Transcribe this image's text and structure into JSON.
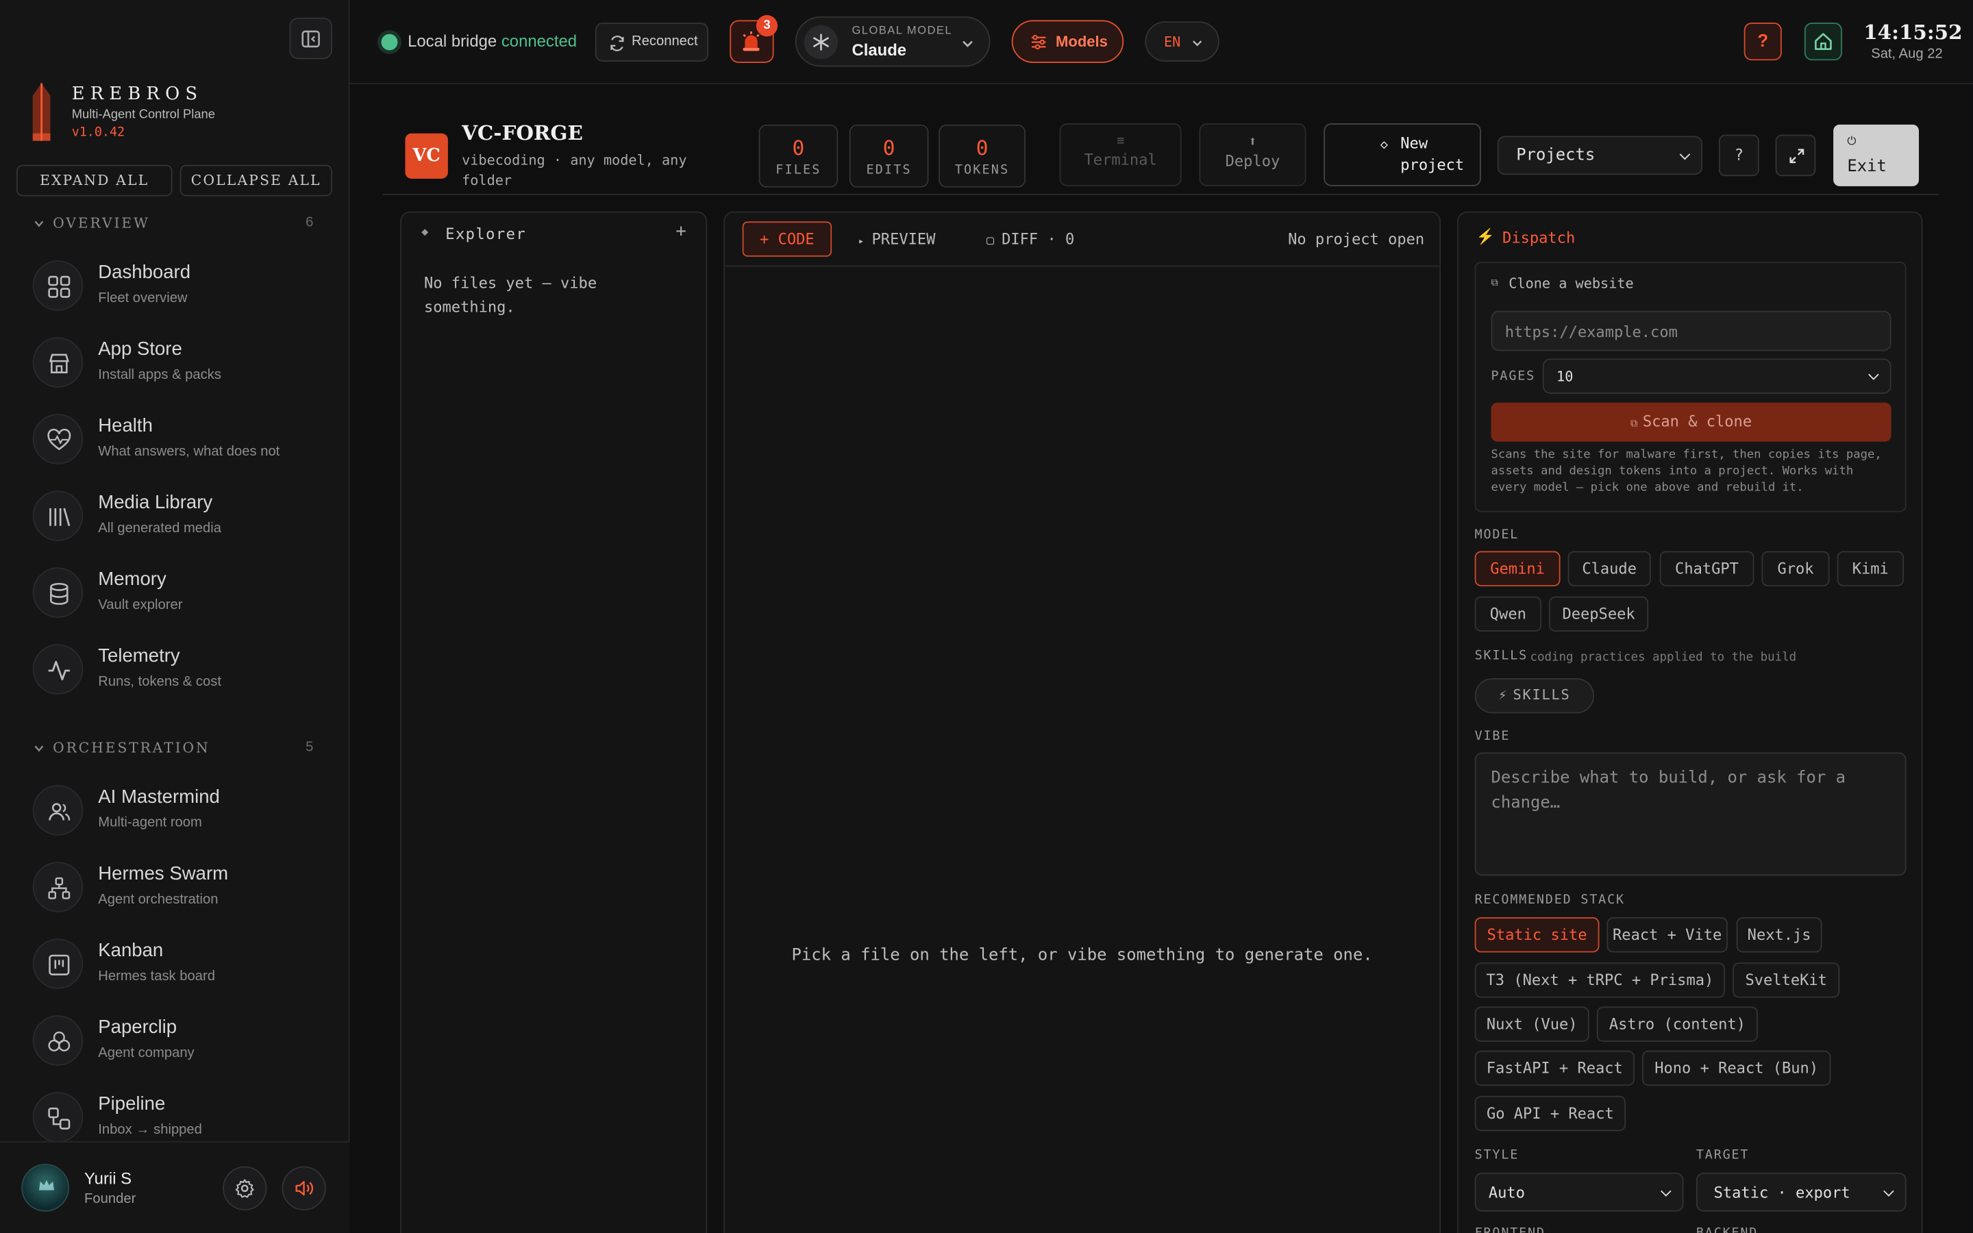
{
  "sidebar": {
    "brand": {
      "name": "EREBROS",
      "tagline": "Multi-Agent Control Plane",
      "version": "v1.0.42"
    },
    "expand_all": "EXPAND ALL",
    "collapse_all": "COLLAPSE ALL",
    "sections": [
      {
        "title": "OVERVIEW",
        "count": "6",
        "items": [
          {
            "label": "Dashboard",
            "sub": "Fleet overview",
            "icon": "grid-icon"
          },
          {
            "label": "App Store",
            "sub": "Install apps & packs",
            "icon": "store-icon"
          },
          {
            "label": "Health",
            "sub": "What answers, what does not",
            "icon": "heart-pulse-icon"
          },
          {
            "label": "Media Library",
            "sub": "All generated media",
            "icon": "library-icon"
          },
          {
            "label": "Memory",
            "sub": "Vault explorer",
            "icon": "database-icon"
          },
          {
            "label": "Telemetry",
            "sub": "Runs, tokens & cost",
            "icon": "activity-icon"
          }
        ]
      },
      {
        "title": "ORCHESTRATION",
        "count": "5",
        "items": [
          {
            "label": "AI Mastermind",
            "sub": "Multi-agent room",
            "icon": "users-icon"
          },
          {
            "label": "Hermes Swarm",
            "sub": "Agent orchestration",
            "icon": "network-icon"
          },
          {
            "label": "Kanban",
            "sub": "Hermes task board",
            "icon": "kanban-icon"
          },
          {
            "label": "Paperclip",
            "sub": "Agent company",
            "icon": "circles-icon"
          },
          {
            "label": "Pipeline",
            "sub": "Inbox → shipped",
            "icon": "workflow-icon"
          }
        ]
      }
    ],
    "user": {
      "name": "Yurii S",
      "role": "Founder"
    }
  },
  "topbar": {
    "bridge_text": "Local bridge",
    "bridge_status": "connected",
    "reconnect": "Reconnect",
    "alert_count": "3",
    "global_model_label": "GLOBAL MODEL",
    "global_model_value": "Claude",
    "models_button": "Models",
    "language": "EN",
    "help": "?",
    "clock_time": "14:15:52",
    "clock_date": "Sat, Aug 22"
  },
  "forge": {
    "logo": "VC",
    "title": "VC-FORGE",
    "subtitle": "vibecoding · any model, any folder",
    "stats": [
      {
        "value": "0",
        "label": "FILES"
      },
      {
        "value": "0",
        "label": "EDITS"
      },
      {
        "value": "0",
        "label": "TOKENS"
      }
    ],
    "terminal": "Terminal",
    "deploy": "Deploy",
    "new_project": "New project",
    "projects_select": "Projects",
    "help": "?",
    "exit": "Exit"
  },
  "explorer": {
    "title": "Explorer",
    "add": "+",
    "empty": "No files yet — vibe something."
  },
  "editor": {
    "tab_code": "+ CODE",
    "tab_preview": "PREVIEW",
    "tab_diff": "DIFF · 0",
    "status": "No project open",
    "placeholder": "Pick a file on the left, or vibe something to generate one."
  },
  "dispatch": {
    "title": "Dispatch",
    "clone": {
      "title": "Clone a website",
      "url_placeholder": "https://example.com",
      "pages_label": "PAGES",
      "pages_value": "10",
      "button": "Scan & clone",
      "description": "Scans the site for malware first, then copies its page, assets and design tokens into a project. Works with every model — pick one above and rebuild it."
    },
    "model_label": "MODEL",
    "models": [
      "Gemini",
      "Claude",
      "ChatGPT",
      "Grok",
      "Kimi",
      "Qwen",
      "DeepSeek"
    ],
    "active_model": "Gemini",
    "skills_label": "SKILLS",
    "skills_hint": "coding practices applied to the build",
    "skills_button": "SKILLS",
    "vibe_label": "VIBE",
    "vibe_placeholder": "Describe what to build, or ask for a change…",
    "stack_label": "RECOMMENDED STACK",
    "stacks": [
      "Static site",
      "React + Vite",
      "Next.js",
      "T3 (Next + tRPC + Prisma)",
      "SvelteKit",
      "Nuxt (Vue)",
      "Astro (content)",
      "FastAPI + React",
      "Hono + React (Bun)",
      "Go API + React"
    ],
    "active_stack": "Static site",
    "style_label": "STYLE",
    "style_value": "Auto",
    "target_label": "TARGET",
    "target_value": "Static · export",
    "frontend_label": "FRONTEND",
    "backend_label": "BACKEND"
  },
  "colors": {
    "accent": "#ff5a36",
    "success": "#4fc08d",
    "background": "#0f0f10"
  }
}
